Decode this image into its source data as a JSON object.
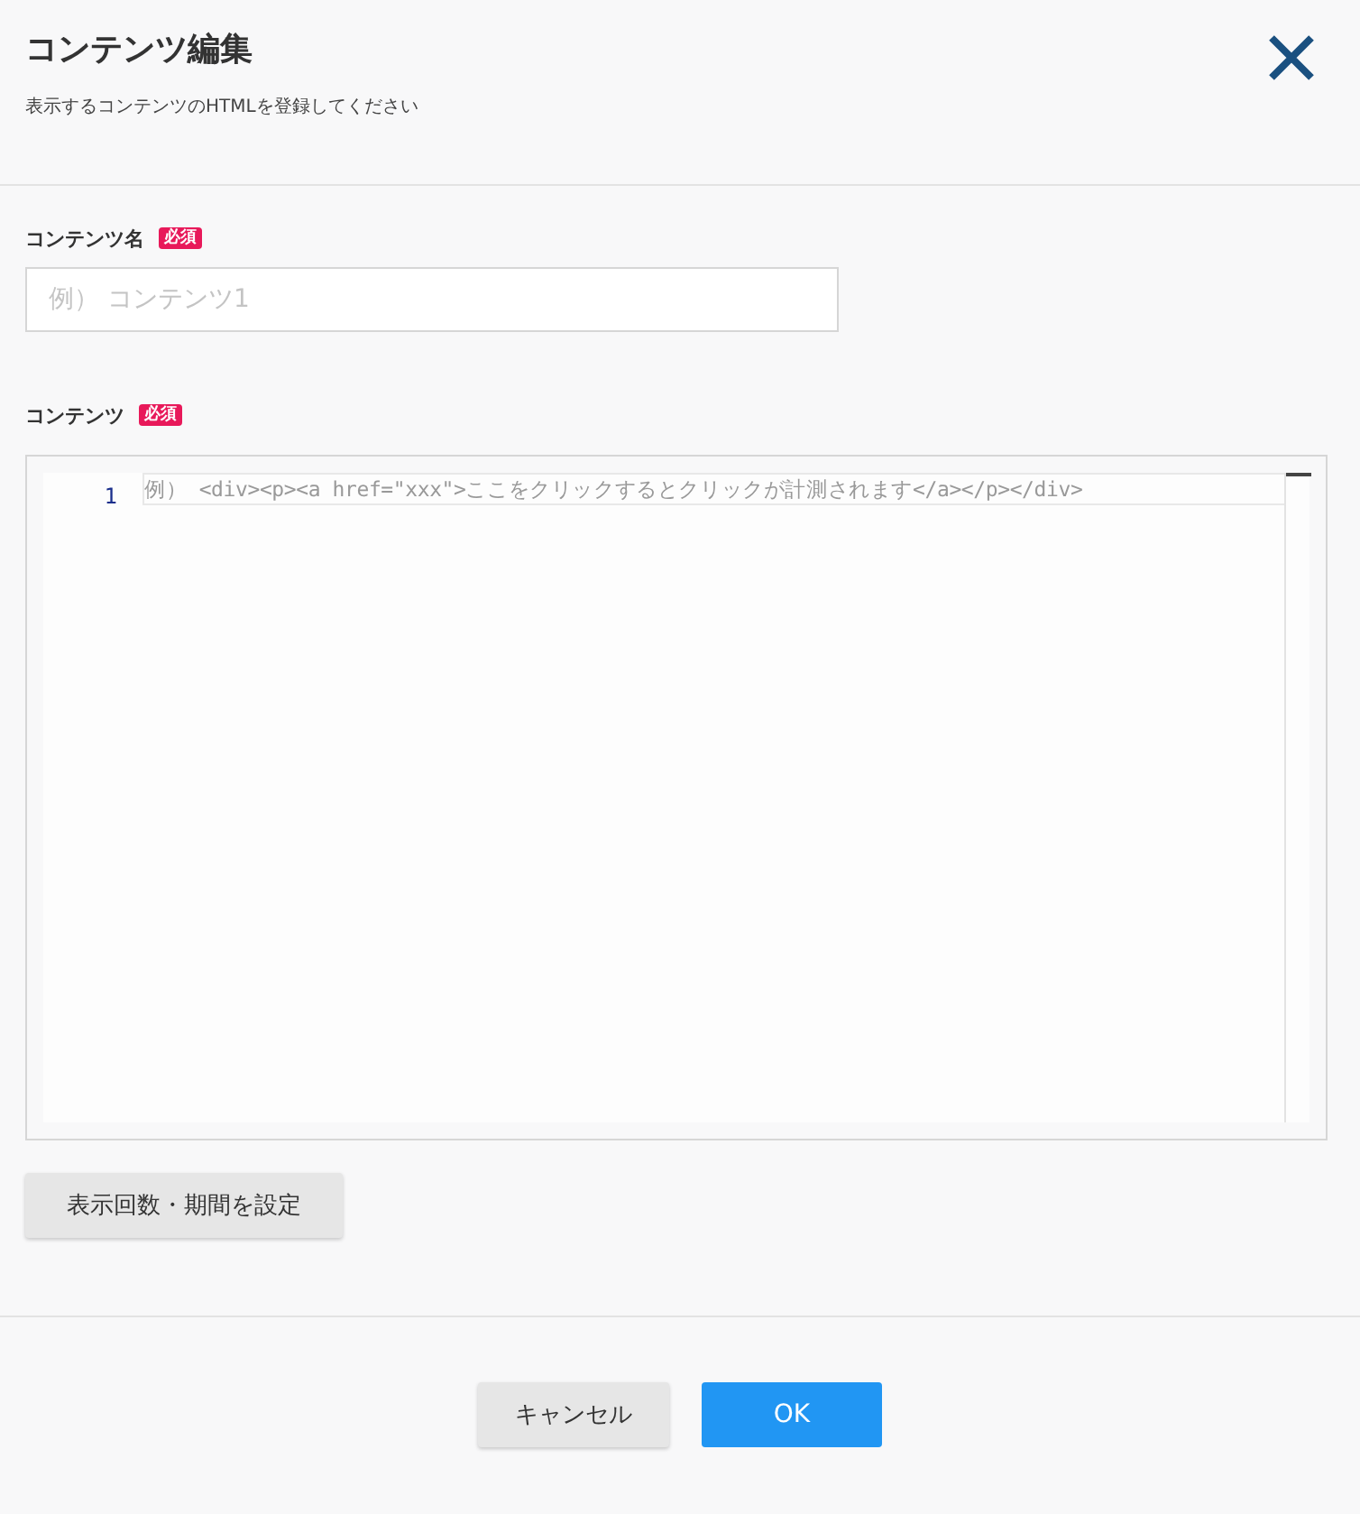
{
  "dialog": {
    "title": "コンテンツ編集",
    "subtitle": "表示するコンテンツのHTMLを登録してください"
  },
  "name_field": {
    "label": "コンテンツ名",
    "required_badge": "必須",
    "placeholder": "例） コンテンツ1"
  },
  "content_editor": {
    "label": "コンテンツ",
    "required_badge": "必須",
    "line_numbers": [
      "1"
    ],
    "placeholder": "例） <div><p><a href=\"xxx\">ここをクリックするとクリックが計測されます</a></p></div>"
  },
  "schedule_button": "表示回数・期間を設定",
  "buttons": [
    {
      "label": "キャンセル",
      "kind": "secondary"
    },
    {
      "label": "OK",
      "kind": "primary"
    }
  ]
}
